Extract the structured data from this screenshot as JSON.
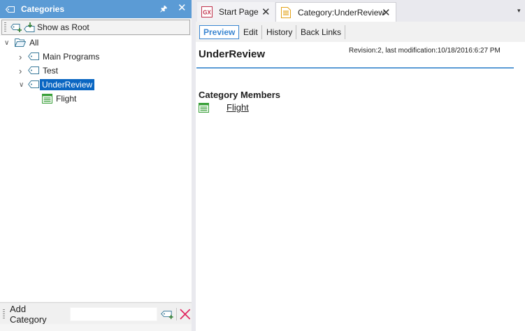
{
  "left_panel": {
    "title": "Categories",
    "pin_glyph": "←",
    "close_glyph": "✕",
    "toolbar": {
      "show_as_root": "Show as Root"
    },
    "tree": [
      {
        "label": "All",
        "expander": "∨",
        "icon": "folder-open-icon",
        "selected": false
      },
      {
        "label": "Main Programs",
        "expander": "›",
        "icon": "category-tag-icon",
        "selected": false
      },
      {
        "label": "Test",
        "expander": "›",
        "icon": "category-tag-icon",
        "selected": false
      },
      {
        "label": "UnderReview",
        "expander": "∨",
        "icon": "category-tag-icon",
        "selected": true
      },
      {
        "label": "Flight",
        "expander": "",
        "icon": "transaction-icon",
        "selected": false
      }
    ],
    "bottom": {
      "add_label": "Add Category",
      "input_value": "",
      "input_placeholder": ""
    }
  },
  "tabs": [
    {
      "label": "Start Page",
      "icon": "gx-icon",
      "active": false,
      "close_glyph": "✕"
    },
    {
      "label": "Category:UnderReview",
      "icon": "category-doc-icon",
      "active": true,
      "close_glyph": "✕"
    }
  ],
  "tab_menu_glyph": "▾",
  "subnav": [
    {
      "label": "Preview",
      "active": true
    },
    {
      "label": "Edit",
      "active": false
    },
    {
      "label": "History",
      "active": false
    },
    {
      "label": "Back Links",
      "active": false
    }
  ],
  "content": {
    "title": "UnderReview",
    "revision": "Revision:2, last modification:10/18/2016:6:27 PM",
    "members_heading": "Category Members",
    "members": [
      {
        "label": "Flight",
        "icon": "transaction-icon"
      }
    ]
  },
  "colors": {
    "accent": "#5b9bd5",
    "selection": "#0a66c2",
    "link_active": "#3b86d1",
    "transaction_green": "#3aa03a",
    "delete_red": "#e0245e"
  }
}
